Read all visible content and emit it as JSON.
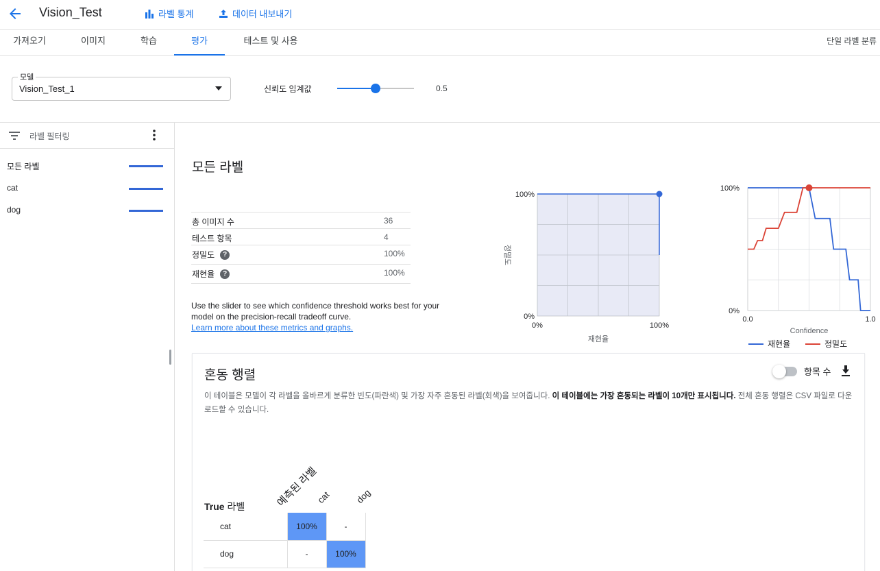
{
  "header": {
    "title": "Vision_Test",
    "label_stats": "라벨 통계",
    "export_data": "데이터 내보내기"
  },
  "tabs": [
    "가져오기",
    "이미지",
    "학습",
    "평가",
    "테스트 및 사용"
  ],
  "active_tab": "평가",
  "model_type": "단일 라벨 분류",
  "model": {
    "label": "모델",
    "value": "Vision_Test_1"
  },
  "threshold": {
    "label": "신뢰도 임계값",
    "value": "0.5",
    "fraction": 0.5
  },
  "sidebar": {
    "filter_placeholder": "라벨 필터링",
    "items": [
      {
        "label": "모든 라벨"
      },
      {
        "label": "cat"
      },
      {
        "label": "dog"
      }
    ]
  },
  "main": {
    "title": "모든 라벨",
    "metrics": [
      {
        "name": "총 이미지 수",
        "value": "36"
      },
      {
        "name": "테스트 항목",
        "value": "4"
      },
      {
        "name": "정밀도",
        "value": "100%"
      },
      {
        "name": "재현율",
        "value": "100%"
      }
    ],
    "explain": "Use the slider to see which confidence threshold works best for your model on the precision-recall tradeoff curve.",
    "learn_more": "Learn more about these metrics and graphs."
  },
  "chart_data": [
    {
      "type": "line",
      "title": "",
      "xlabel": "재현율",
      "ylabel": "정밀도",
      "xlim": [
        0,
        1
      ],
      "ylim": [
        0,
        1
      ],
      "x_ticks": [
        "0%",
        "100%"
      ],
      "y_ticks": [
        "0%",
        "100%"
      ],
      "series": [
        {
          "x": [
            0,
            1,
            1
          ],
          "y": [
            1,
            1,
            0.5
          ]
        }
      ],
      "highlight_point": {
        "x": 1,
        "y": 1
      },
      "fill": true,
      "grid": true
    },
    {
      "type": "line",
      "xlabel": "Confidence",
      "xlim": [
        0,
        1
      ],
      "ylim": [
        0,
        1
      ],
      "x_ticks": [
        "0.0",
        "1.0"
      ],
      "y_ticks": [
        "0%",
        "100%"
      ],
      "legend": "bottom",
      "series": [
        {
          "name": "재현율",
          "color": "#3367d6",
          "x": [
            0,
            0.5,
            0.55,
            0.67,
            0.7,
            0.8,
            0.83,
            0.9,
            0.92,
            0.97,
            1.0
          ],
          "y": [
            1,
            1,
            0.75,
            0.75,
            0.5,
            0.5,
            0.25,
            0.25,
            0,
            0,
            0
          ]
        },
        {
          "name": "정밀도",
          "color": "#db4437",
          "x": [
            0,
            0.05,
            0.08,
            0.12,
            0.15,
            0.2,
            0.25,
            0.3,
            0.35,
            0.4,
            0.45,
            0.5,
            1.0
          ],
          "y": [
            0.5,
            0.5,
            0.57,
            0.57,
            0.67,
            0.67,
            0.67,
            0.8,
            0.8,
            0.8,
            1,
            1,
            1
          ]
        }
      ],
      "highlight_point": {
        "x": 0.5,
        "y": 1
      },
      "grid": true
    }
  ],
  "confusion": {
    "title": "혼동 행렬",
    "toggle_label": "항목 수",
    "desc_plain": "이 테이블은 모델이 각 라벨을 올바르게 분류한 빈도(파란색) 및 가장 자주 혼동된 라벨(회색)을 보여줍니다. ",
    "desc_bold": "이 테이블에는 가장 혼동되는 라벨이 10개만 표시됩니다.",
    "desc_tail": " 전체 혼동 행렬은 CSV 파일로 다운로드할 수 있습니다.",
    "true_label_prefix": "True",
    "true_label_suffix": " 라벨",
    "predicted_label": "예측된 라벨",
    "columns": [
      "cat",
      "dog"
    ],
    "rows": [
      {
        "label": "cat",
        "cells": [
          "100%",
          "-"
        ]
      },
      {
        "label": "dog",
        "cells": [
          "-",
          "100%"
        ]
      }
    ]
  }
}
